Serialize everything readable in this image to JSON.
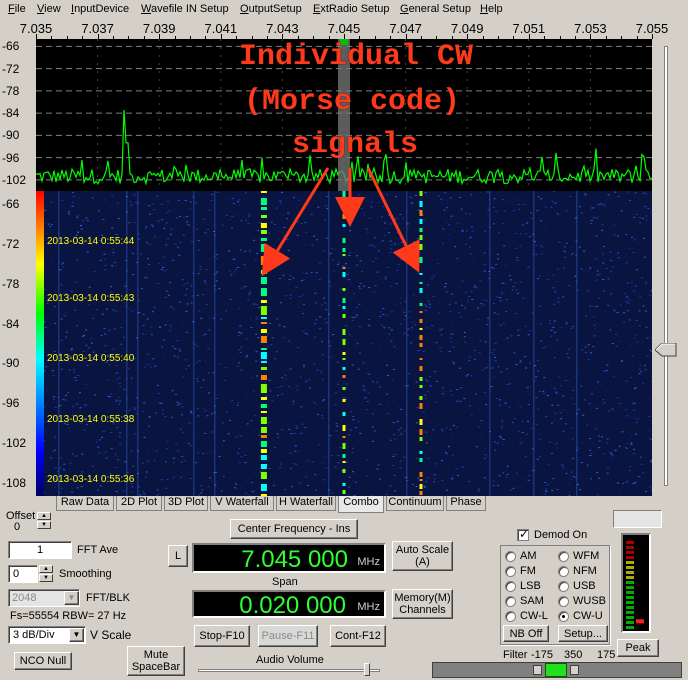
{
  "menu": [
    {
      "label": "File",
      "key": "F",
      "rest": "ile"
    },
    {
      "label": "View",
      "key": "V",
      "rest": "iew"
    },
    {
      "label": "InputDevice",
      "key": "I",
      "rest": "nputDevice"
    },
    {
      "label": "Wavefile IN Setup",
      "key": "W",
      "rest": "avefile IN Setup"
    },
    {
      "label": "OutputSetup",
      "key": "O",
      "rest": "utputSetup"
    },
    {
      "label": "ExtRadio Setup",
      "key": "E",
      "rest": "xtRadio Setup"
    },
    {
      "label": "General Setup",
      "key": "G",
      "rest": "eneral Setup"
    },
    {
      "label": "Help",
      "key": "H",
      "rest": "elp"
    }
  ],
  "ruler": {
    "freqs": [
      "7.035",
      "7.037",
      "7.039",
      "7.041",
      "7.043",
      "7.045",
      "7.047",
      "7.049",
      "7.051",
      "7.053",
      "7.055"
    ]
  },
  "spectrum": {
    "db_labels": [
      "-66",
      "-72",
      "-78",
      "-84",
      "-90",
      "-96",
      "-102"
    ],
    "ylim": [
      -105,
      -64
    ],
    "grid_color": "#808080",
    "trace_color": "#00ff00",
    "center_marker_color": "#00c000"
  },
  "waterfall": {
    "db_labels": [
      "-66",
      "-72",
      "-78",
      "-84",
      "-90",
      "-96",
      "-102",
      "-108"
    ],
    "timestamps": [
      "2013-03-14 0:55:44",
      "2013-03-14 0:55:43",
      "2013-03-14 0:55:40",
      "2013-03-14 0:55:38",
      "2013-03-14 0:55:36"
    ],
    "signal_freqs_mhz": [
      7.0424,
      7.045,
      7.0475
    ],
    "background_color": "#0a1440"
  },
  "annotation": {
    "line1": "Individual CW",
    "line2": "(Morse code)",
    "line3": "signals",
    "color": "#ff3a1a"
  },
  "tabs": [
    {
      "label": "Raw Data",
      "active": false
    },
    {
      "label": "2D Plot",
      "active": false
    },
    {
      "label": "3D Plot",
      "active": false
    },
    {
      "label": "V Waterfall",
      "active": false
    },
    {
      "label": "H Waterfall",
      "active": false
    },
    {
      "label": "Combo",
      "active": true
    },
    {
      "label": "Continuum",
      "active": false
    },
    {
      "label": "Phase",
      "active": false
    }
  ],
  "controls": {
    "offset_label": "Offset",
    "offset_value": "0",
    "fft_ave_value": "1",
    "fft_ave_label": "FFT Ave",
    "smoothing_value": "0",
    "smoothing_label": "Smoothing",
    "fft_blk_value": "2048",
    "fft_blk_label": "FFT/BLK",
    "fs_text": "Fs=55554 RBW=  27 Hz",
    "vscale_value": "3 dB/Div",
    "vscale_label": "V Scale",
    "nco_null": "NCO Null",
    "mute_line1": "Mute",
    "mute_line2": "SpaceBar",
    "center_freq_button": "Center Frequency - Ins",
    "l_button": "L",
    "center_freq_value": "7.045 000",
    "center_freq_unit": "MHz",
    "span_label": "Span",
    "span_value": "0.020 000",
    "span_unit": "MHz",
    "auto_scale_line1": "Auto Scale",
    "auto_scale_line2": "(A)",
    "memory_line1": "Memory(M)",
    "memory_line2": "Channels",
    "stop_button": "Stop-F10",
    "pause_button": "Pause-F11",
    "cont_button": "Cont-F12",
    "audio_volume_label": "Audio Volume",
    "audio_volume_level": 0.94
  },
  "demod": {
    "demod_on_label": "Demod On",
    "demod_on_checked": true,
    "modes": [
      {
        "label": "AM",
        "selected": false
      },
      {
        "label": "WFM",
        "selected": false
      },
      {
        "label": "FM",
        "selected": false
      },
      {
        "label": "NFM",
        "selected": false
      },
      {
        "label": "LSB",
        "selected": false
      },
      {
        "label": "USB",
        "selected": false
      },
      {
        "label": "SAM",
        "selected": false
      },
      {
        "label": "WUSB",
        "selected": false
      },
      {
        "label": "CW-L",
        "selected": false
      },
      {
        "label": "CW-U",
        "selected": true
      }
    ],
    "nb_off": "NB Off",
    "setup": "Setup...",
    "peak": "Peak",
    "filter_label": "Filter",
    "filter_values": [
      "-175",
      "350",
      "175"
    ],
    "meter_level": 0.08
  }
}
